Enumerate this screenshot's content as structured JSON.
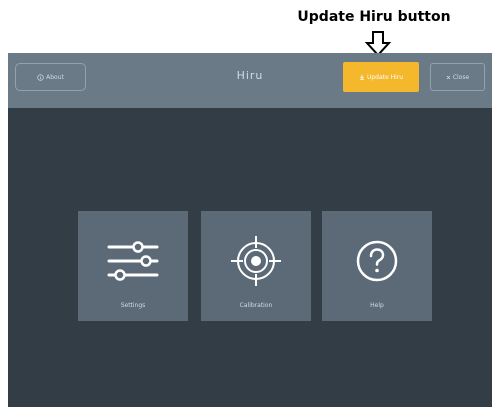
{
  "annotation": {
    "label": "Update Hiru button"
  },
  "topbar": {
    "about_icon": "info-circle-icon",
    "about_label": "About",
    "title": "Hiru",
    "update_icon": "download-arrow-icon",
    "update_label": "Update Hiru",
    "close_icon": "x-icon",
    "close_label": "Close"
  },
  "tiles": [
    {
      "label": "Settings",
      "icon": "sliders-icon"
    },
    {
      "label": "Calibration",
      "icon": "crosshair-target-icon"
    },
    {
      "label": "Help",
      "icon": "question-circle-icon"
    }
  ],
  "colors": {
    "background": "#333d45",
    "topbar": "#6a7a87",
    "tile": "#5b6a76",
    "accent": "#f5b72c",
    "text": "#d3dbe2"
  }
}
